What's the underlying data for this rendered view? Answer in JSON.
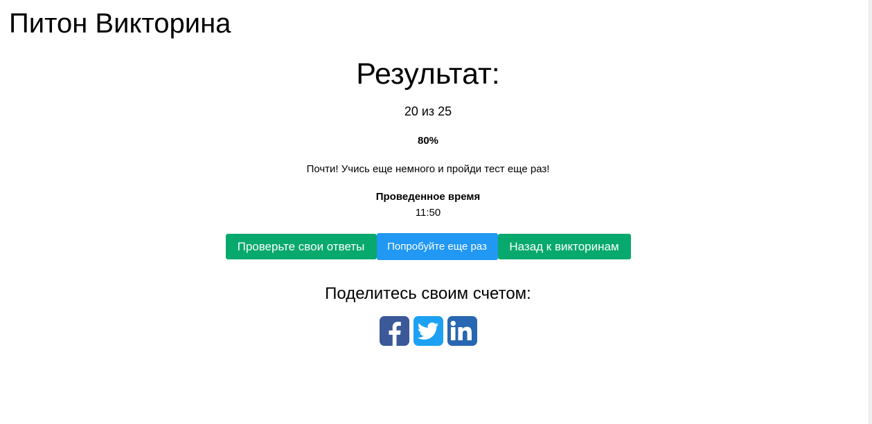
{
  "header": {
    "app_title": "Питон Викторина"
  },
  "result": {
    "title": "Результат:",
    "score": "20 из 25",
    "percent": "80%",
    "message": "Почти! Учись еще немного и пройди тест еще раз!",
    "time_label": "Проведенное время",
    "time_value": "11:50"
  },
  "actions": {
    "check_answers_label": "Проверьте свои ответы",
    "try_again_label": "Попробуйте еще раз",
    "back_label": "Назад к викторинам"
  },
  "share": {
    "title": "Поделитесь своим счетом:",
    "icons": [
      "facebook-icon",
      "twitter-icon",
      "linkedin-icon"
    ]
  },
  "colors": {
    "green_button": "#07a96d",
    "blue_button": "#2198f3",
    "facebook": "#3b5998",
    "twitter": "#1da1f2",
    "linkedin": "#2867b2"
  }
}
